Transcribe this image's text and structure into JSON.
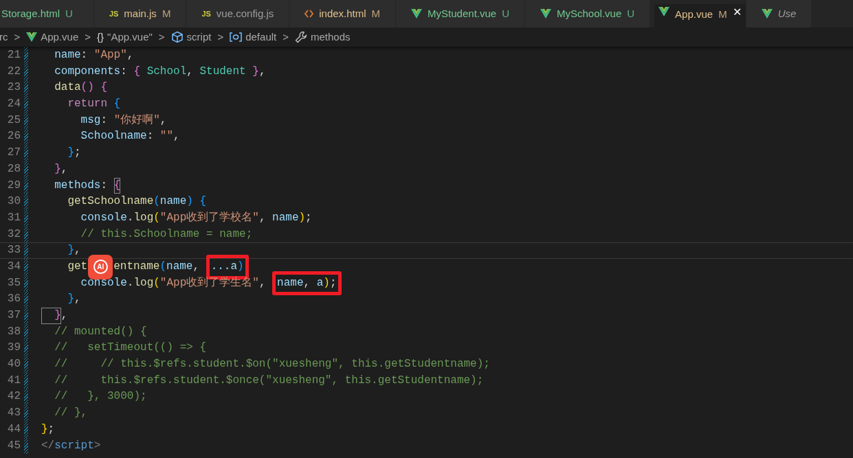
{
  "tabs": [
    {
      "kind": "plain",
      "label": "Storage.html",
      "status": "U",
      "selected": false,
      "preview": false,
      "highlighted": false
    },
    {
      "kind": "js",
      "badge": "JS",
      "label": "main.js",
      "status": "M",
      "selected": false,
      "preview": false,
      "highlighted": false
    },
    {
      "kind": "js",
      "badge": "JS",
      "label": "vue.config.js",
      "selected": false,
      "preview": false,
      "highlighted": false
    },
    {
      "kind": "html",
      "label": "index.html",
      "status": "M",
      "selected": false,
      "preview": false,
      "highlighted": false
    },
    {
      "kind": "vue",
      "label": "MyStudent.vue",
      "status": "U",
      "selected": false,
      "preview": false,
      "highlighted": false
    },
    {
      "kind": "vue",
      "label": "MySchool.vue",
      "status": "U",
      "selected": false,
      "preview": false,
      "highlighted": false
    },
    {
      "kind": "vue",
      "label": "App.vue",
      "status": "M",
      "selected": true,
      "preview": false,
      "highlighted": true,
      "close": "✕"
    },
    {
      "kind": "vue",
      "label": "Use",
      "selected": false,
      "preview": true,
      "highlighted": false
    }
  ],
  "breadcrumb": [
    {
      "kind": "plain",
      "label": "rc"
    },
    {
      "kind": "vue",
      "label": "App.vue"
    },
    {
      "kind": "braces",
      "glyph": "{}",
      "label": "\"App.vue\""
    },
    {
      "kind": "cube",
      "label": "script"
    },
    {
      "kind": "symbol",
      "label": "default"
    },
    {
      "kind": "wrench",
      "label": "methods"
    }
  ],
  "separator": ">",
  "lines": [
    {
      "number": "21",
      "tokens": [
        {
          "text": "  name",
          "kind": "prop"
        },
        {
          "text": ": ",
          "kind": "punct"
        },
        {
          "text": "\"App\"",
          "kind": "str"
        },
        {
          "text": ",",
          "kind": "punct"
        }
      ]
    },
    {
      "number": "22",
      "tokens": [
        {
          "text": "  components",
          "kind": "prop"
        },
        {
          "text": ": ",
          "kind": "punct"
        },
        {
          "text": "{",
          "kind": "brace2"
        },
        {
          "text": " School",
          "kind": "comp"
        },
        {
          "text": ", ",
          "kind": "punct"
        },
        {
          "text": "Student ",
          "kind": "comp"
        },
        {
          "text": "}",
          "kind": "brace2"
        },
        {
          "text": ",",
          "kind": "punct"
        }
      ]
    },
    {
      "number": "23",
      "tokens": [
        {
          "text": "  data",
          "kind": "fn"
        },
        {
          "text": "()",
          "kind": "brace2"
        },
        {
          "text": " {",
          "kind": "brace2"
        }
      ]
    },
    {
      "number": "24",
      "tokens": [
        {
          "text": "    return",
          "kind": "kw"
        },
        {
          "text": " {",
          "kind": "brace3"
        }
      ]
    },
    {
      "number": "25",
      "tokens": [
        {
          "text": "      msg",
          "kind": "prop"
        },
        {
          "text": ": ",
          "kind": "punct"
        },
        {
          "text": "\"你好啊\"",
          "kind": "str"
        },
        {
          "text": ",",
          "kind": "punct"
        }
      ]
    },
    {
      "number": "26",
      "tokens": [
        {
          "text": "      Schoolname",
          "kind": "prop"
        },
        {
          "text": ": ",
          "kind": "punct"
        },
        {
          "text": "\"\"",
          "kind": "str"
        },
        {
          "text": ",",
          "kind": "punct"
        }
      ]
    },
    {
      "number": "27",
      "tokens": [
        {
          "text": "    }",
          "kind": "brace3"
        },
        {
          "text": ";",
          "kind": "punct"
        }
      ]
    },
    {
      "number": "28",
      "tokens": [
        {
          "text": "  }",
          "kind": "brace2"
        },
        {
          "text": ",",
          "kind": "punct"
        }
      ]
    },
    {
      "number": "29",
      "tokens": [
        {
          "text": "  methods",
          "kind": "prop"
        },
        {
          "text": ": ",
          "kind": "punct"
        },
        {
          "text": "{",
          "kind": "brace2",
          "matched": true
        }
      ]
    },
    {
      "number": "30",
      "tokens": [
        {
          "text": "    getSchoolname",
          "kind": "fn"
        },
        {
          "text": "(",
          "kind": "brace3"
        },
        {
          "text": "name",
          "kind": "prop"
        },
        {
          "text": ")",
          "kind": "brace3"
        },
        {
          "text": " {",
          "kind": "brace3"
        }
      ]
    },
    {
      "number": "31",
      "tokens": [
        {
          "text": "      console",
          "kind": "prop"
        },
        {
          "text": ".",
          "kind": "punct"
        },
        {
          "text": "log",
          "kind": "fn"
        },
        {
          "text": "(",
          "kind": "brace1"
        },
        {
          "text": "\"App收到了学校名\"",
          "kind": "str"
        },
        {
          "text": ", ",
          "kind": "punct"
        },
        {
          "text": "name",
          "kind": "prop"
        },
        {
          "text": ")",
          "kind": "brace1"
        },
        {
          "text": ";",
          "kind": "punct"
        }
      ]
    },
    {
      "number": "32",
      "tokens": [
        {
          "text": "      // this.Schoolname = name;",
          "kind": "comment"
        }
      ]
    },
    {
      "number": "33",
      "current": true,
      "tokens": [
        {
          "text": "    }",
          "kind": "brace3"
        },
        {
          "text": ",",
          "kind": "punct"
        }
      ]
    },
    {
      "number": "34",
      "tokens": [
        {
          "text": "    get",
          "kind": "fn"
        },
        {
          "text": "AI",
          "kind": "ai-badge"
        },
        {
          "text": "entname",
          "kind": "fn"
        },
        {
          "text": "(",
          "kind": "brace3"
        },
        {
          "text": "name",
          "kind": "prop"
        },
        {
          "text": ", ",
          "kind": "punct"
        },
        {
          "text": "...a",
          "kind": "prop",
          "boxed": true
        },
        {
          "text": ")",
          "kind": "brace3",
          "boxed": true
        }
      ]
    },
    {
      "number": "35",
      "tokens": [
        {
          "text": "      console",
          "kind": "prop"
        },
        {
          "text": ".",
          "kind": "punct"
        },
        {
          "text": "log",
          "kind": "fn"
        },
        {
          "text": "(",
          "kind": "brace1"
        },
        {
          "text": "\"App收到了学生名\"",
          "kind": "str"
        },
        {
          "text": ", ",
          "kind": "punct"
        },
        {
          "text": "name",
          "kind": "prop",
          "boxed": true
        },
        {
          "text": ", ",
          "kind": "punct",
          "boxed": true
        },
        {
          "text": "a",
          "kind": "prop",
          "boxed": true
        },
        {
          "text": ")",
          "kind": "brace1",
          "boxed": true
        },
        {
          "text": ";",
          "kind": "punct",
          "boxed": true
        }
      ]
    },
    {
      "number": "36",
      "tokens": [
        {
          "text": "    }",
          "kind": "brace3"
        },
        {
          "text": ",",
          "kind": "punct"
        }
      ]
    },
    {
      "number": "37",
      "tokens": [
        {
          "text": "  }",
          "kind": "brace2",
          "matched": true
        },
        {
          "text": ",",
          "kind": "punct"
        }
      ]
    },
    {
      "number": "38",
      "tokens": [
        {
          "text": "  // mounted() {",
          "kind": "comment"
        }
      ]
    },
    {
      "number": "39",
      "tokens": [
        {
          "text": "  //   setTimeout(() => {",
          "kind": "comment"
        }
      ]
    },
    {
      "number": "40",
      "tokens": [
        {
          "text": "  //     // this.$refs.student.$on(\"xuesheng\", this.getStudentname);",
          "kind": "comment"
        }
      ]
    },
    {
      "number": "41",
      "tokens": [
        {
          "text": "  //     this.$refs.student.$once(\"xuesheng\", this.getStudentname);",
          "kind": "comment"
        }
      ]
    },
    {
      "number": "42",
      "tokens": [
        {
          "text": "  //   }, 3000);",
          "kind": "comment"
        }
      ]
    },
    {
      "number": "43",
      "tokens": [
        {
          "text": "  // },",
          "kind": "comment"
        }
      ]
    },
    {
      "number": "44",
      "tokens": [
        {
          "text": "}",
          "kind": "brace1"
        },
        {
          "text": ";",
          "kind": "punct"
        }
      ]
    },
    {
      "number": "45",
      "tokens": [
        {
          "text": "</",
          "kind": "tagpunct"
        },
        {
          "text": "script",
          "kind": "tagname"
        },
        {
          "text": ">",
          "kind": "tagpunct"
        }
      ]
    }
  ]
}
